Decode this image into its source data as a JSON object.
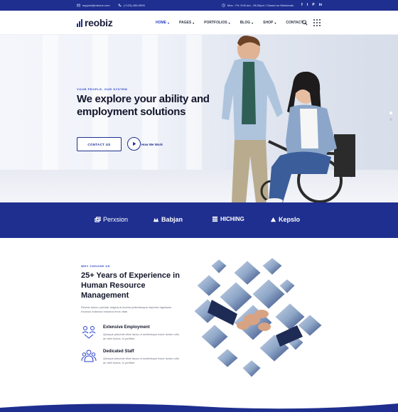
{
  "topbar": {
    "email": "support@orbone.com",
    "phone": "(+123) 456-9909",
    "hours": "Mon - Fri: 9:00 am - 06.00pm / Closed on Weekends",
    "social": [
      "f",
      "t",
      "P",
      "in"
    ]
  },
  "header": {
    "logo": "reobiz",
    "nav": [
      {
        "label": "HOME",
        "active": true
      },
      {
        "label": "PAGES",
        "active": false
      },
      {
        "label": "PORTFOLIOS",
        "active": false
      },
      {
        "label": "BLOG",
        "active": false
      },
      {
        "label": "SHOP",
        "active": false
      },
      {
        "label": "CONTACT",
        "active": false
      }
    ]
  },
  "hero": {
    "kicker": "YOUR PEOPLE, OUR SYSTEM",
    "title": "We explore your ability and employment solutions",
    "cta_label": "CONTACT US",
    "video_label": "How We Work"
  },
  "brands": [
    {
      "name": "Perxsion",
      "icon": "perxsion-logo-icon"
    },
    {
      "name": "Babjan",
      "icon": "babjan-logo-icon"
    },
    {
      "name": "HICHING",
      "icon": "hiching-logo-icon"
    },
    {
      "name": "Kepslo",
      "icon": "kepslo-logo-icon"
    }
  ],
  "why": {
    "kicker": "WHY CHOOSE US",
    "title": "25+ Years of Experience in Human Resource Management",
    "description": "Reobiz donec pulvinar magna id leoersi pellentesque impered dignissim rhoncus euismod euismod eros vitae.",
    "features": [
      {
        "name": "Extensive Employment",
        "description": "Quisque placerat vitae lacus ut scelerisque fusce luctus odio ac nibh luctus, in porttitor.",
        "icon": "employment-icon"
      },
      {
        "name": "Dedicated Staff",
        "description": "Quisque placerat vitae lacus ut scelerisque fusce luctus odio ac nibh luctus, in porttitor.",
        "icon": "staff-icon"
      }
    ]
  },
  "colors": {
    "primary": "#1f2f8f",
    "accent": "#2540c9",
    "dark": "#14172b"
  }
}
